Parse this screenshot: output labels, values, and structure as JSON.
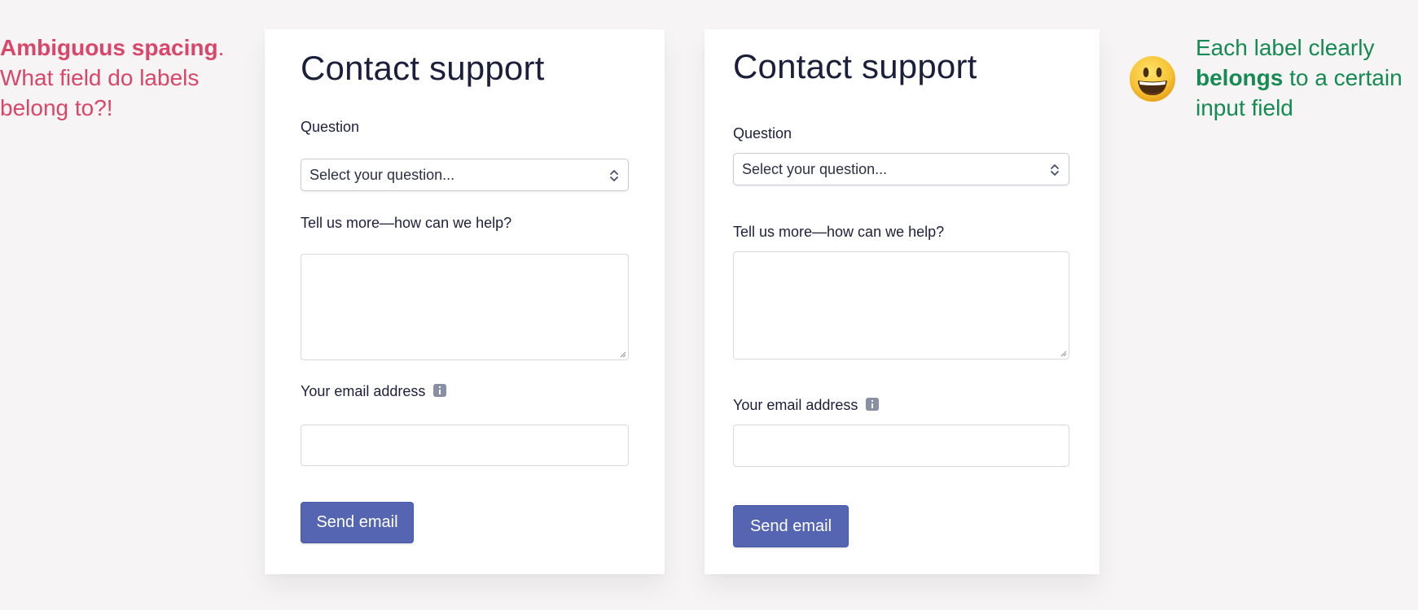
{
  "left_note": {
    "strong": "Ambiguous spacing",
    "period": ".",
    "rest": "What field do labels belong to?!"
  },
  "right_note": {
    "line1": "Each label clearly",
    "strong": "belongs",
    "line2_rest": " to a certain",
    "line3": "input field"
  },
  "emoji": "smiley-face",
  "colors": {
    "bad": "#d9466a",
    "good": "#158a52",
    "button": "#5565b1",
    "text": "#1c1f3b"
  },
  "forms": [
    {
      "title": "Contact support",
      "question_label": "Question",
      "select_value": "Select your question...",
      "message_label": "Tell us more—how can we help?",
      "email_label": "Your email address",
      "submit_label": "Send email"
    },
    {
      "title": "Contact support",
      "question_label": "Question",
      "select_value": "Select your question...",
      "message_label": "Tell us more—how can we help?",
      "email_label": "Your email address",
      "submit_label": "Send email"
    }
  ]
}
